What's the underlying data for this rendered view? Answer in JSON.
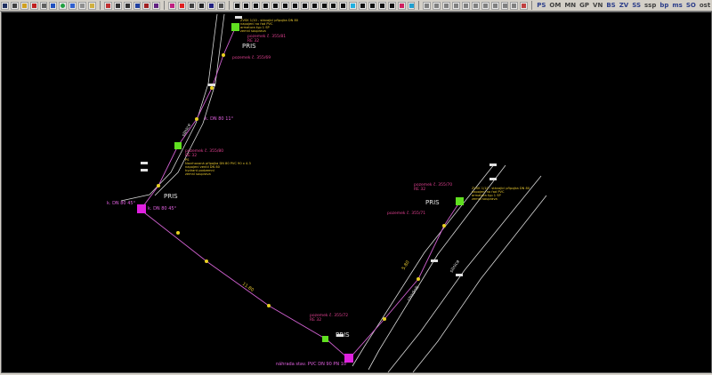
{
  "toolbar": {
    "layer_buttons": [
      "PS",
      "OM",
      "MN",
      "GP",
      "VN",
      "BS",
      "ZV",
      "SS",
      "ssp",
      "bp",
      "ms",
      "SO",
      "ost"
    ]
  },
  "drawing": {
    "labels": {
      "pris_top": "PRIS",
      "pris_left": "PRIS",
      "pris_right": "PRIS",
      "pris_bottom": "PRIS",
      "bend_upper": "k. DN 80 11°",
      "bend_left_1": "k. DN 80 45°",
      "bend_left_2": "k. DN 80 45°",
      "street_left": "silnice",
      "street_right": "silnice",
      "street_right_2": "chodník",
      "replacement_pipe": "náhrada stav. PVC DN 90 PN 10",
      "len_diag": "11.80",
      "len_right": "5.80",
      "parcel_top": "pozemek č. 355/81",
      "parcel_upper": "pozemek č. 355/69",
      "parcel_mid": "pozemek č. 355/80",
      "parcel_right_1": "pozemek č. 355/70",
      "parcel_right_2": "pozemek č. 355/71",
      "parcel_bottom": "pozemek č. 355/72",
      "sheet_top": "RE 32",
      "sheet_mid": "RE 32",
      "sheet_right": "RE 32",
      "sheet_bottom": "RE 32",
      "note_top_1": "ZVSK 1/10 - stávající přípojka DN 80",
      "note_top_2": "napojení na řad PVC",
      "note_top_3": "armatura typ 1 SP",
      "note_top_4": "zemní souprava",
      "note_right_1": "ZVSK 1/10 - stávající přípojka DN 80",
      "note_right_2": "napojení na řad PVC",
      "note_right_3": "armatura typ 1 SP",
      "note_right_4": "zemní souprava",
      "note_mid_1": "PS",
      "note_mid_2": "Navrhovaná přípojka DN 80 PVC 90 x 4.3",
      "note_mid_3": "napojení ventil DN 80",
      "note_mid_4": "hydrant podzemní",
      "note_mid_5": "zemní souprava"
    }
  }
}
